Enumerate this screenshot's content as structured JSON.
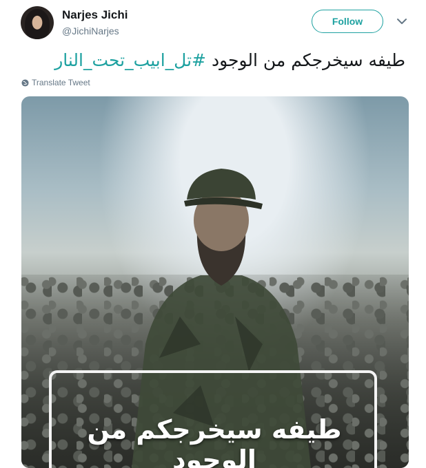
{
  "author": {
    "display_name": "Narjes Jichi",
    "handle": "@JichiNarjes"
  },
  "actions": {
    "follow_label": "Follow"
  },
  "tweet": {
    "text": "طيفه سيخرجكم من الوجود",
    "hashtag": "#تل_ابيب_تحت_النار",
    "translate_label": "Translate Tweet"
  },
  "media": {
    "caption": "طيفه سيخرجكم من الوجود"
  },
  "colors": {
    "accent": "#1da1a0",
    "secondary_text": "#657786"
  },
  "icons": [
    "avatar",
    "chevron-down-icon",
    "globe-icon"
  ]
}
